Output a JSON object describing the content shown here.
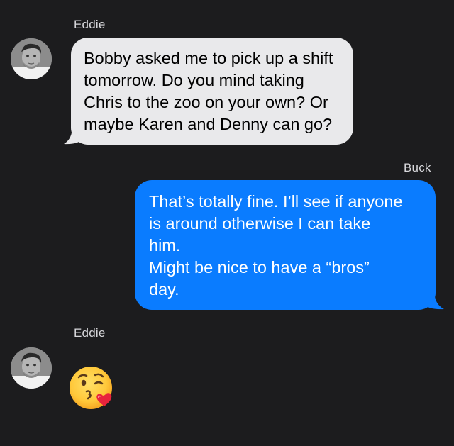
{
  "thread": {
    "messages": [
      {
        "sender": "Eddie",
        "direction": "incoming",
        "lines": [
          "Bobby asked me to pick up a shift",
          "tomorrow. Do you mind taking",
          "Chris to the zoo on your own? Or",
          "maybe Karen and Denny can go?"
        ]
      },
      {
        "sender": "Buck",
        "direction": "outgoing",
        "lines": [
          "That’s totally fine. I’ll see if anyone",
          "is around otherwise I can take",
          "him.",
          "Might be nice to have a “bros”",
          "day."
        ]
      },
      {
        "sender": "Eddie",
        "direction": "incoming",
        "emoji": "kissing-face-with-heart-emoji"
      }
    ]
  },
  "colors": {
    "background": "#1c1c1e",
    "incoming_bubble": "#e9e9eb",
    "outgoing_bubble": "#0a7cff",
    "sender_name": "#d8d8dc"
  },
  "icons": {
    "avatar": "contact-photo",
    "emoji": "kissing-face-with-heart"
  }
}
